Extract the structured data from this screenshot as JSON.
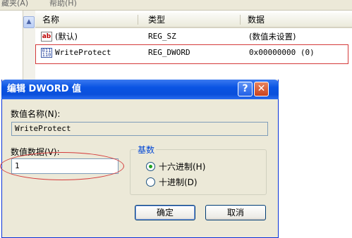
{
  "menubar": {
    "item1": "藏夹(A)",
    "item2": "帮助(H)"
  },
  "list": {
    "headers": {
      "name": "名称",
      "type": "类型",
      "data": "数据"
    },
    "rows": [
      {
        "icon": "string-value-icon",
        "icon_text": "ab",
        "name": "(默认)",
        "type": "REG_SZ",
        "data": "(数值未设置)"
      },
      {
        "icon": "binary-value-icon",
        "icon_text": "011 110",
        "name": "WriteProtect",
        "type": "REG_DWORD",
        "data": "0x00000000 (0)"
      }
    ]
  },
  "dialog": {
    "title": "编辑 DWORD 值",
    "value_name_label": "数值名称(N):",
    "value_name": "WriteProtect",
    "value_data_label": "数值数据(V):",
    "value_data": "1",
    "base_group_label": "基数",
    "base_options": [
      {
        "label": "十六进制(H)",
        "selected": true
      },
      {
        "label": "十进制(D)",
        "selected": false
      }
    ],
    "ok_label": "确定",
    "cancel_label": "取消",
    "help_glyph": "?",
    "close_glyph": "✕"
  },
  "colors": {
    "titlebar": "#0a54e3",
    "highlight_annotation": "#d43a3a",
    "radio_dot": "#21a121",
    "group_title": "#0046d5"
  }
}
